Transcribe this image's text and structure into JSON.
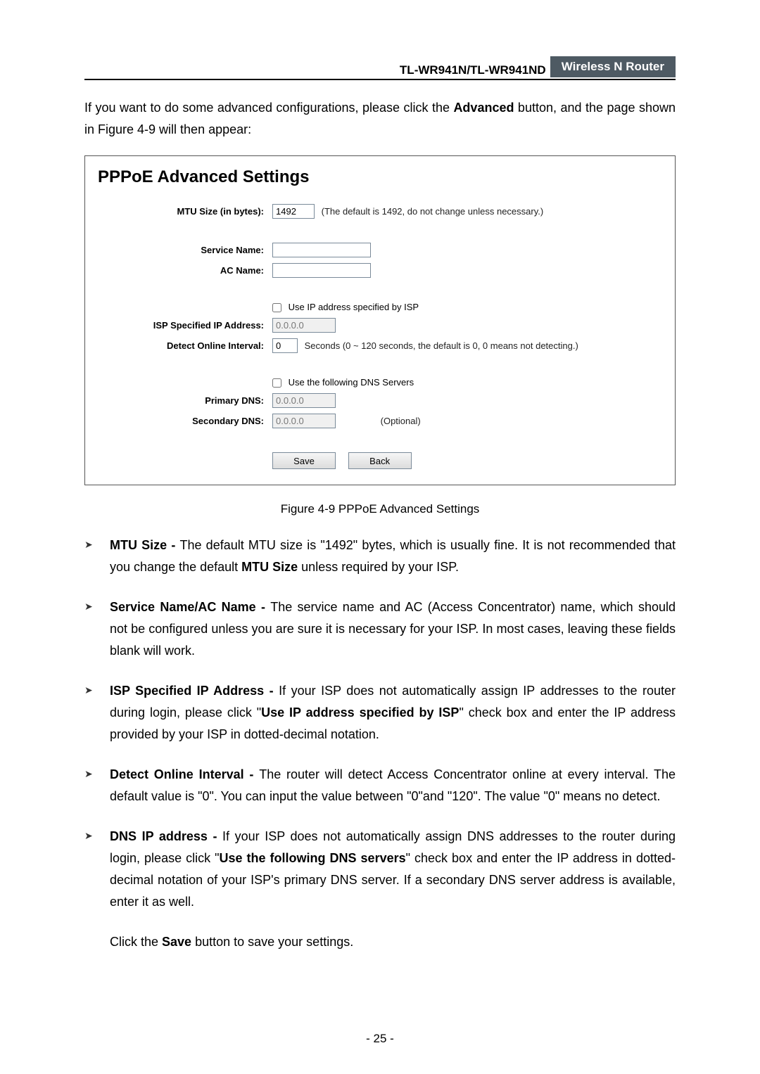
{
  "header": {
    "model": "TL-WR941N/TL-WR941ND",
    "product": "Wireless  N  Router"
  },
  "intro": {
    "p1a": "If you want to do some advanced configurations, please click the ",
    "adv": "Advanced",
    "p1b": " button, and the page shown in Figure 4-9 will then appear:"
  },
  "panel": {
    "title": "PPPoE Advanced Settings",
    "mtu_label": "MTU Size (in bytes):",
    "mtu_value": "1492",
    "mtu_hint": "(The default is 1492, do not change unless necessary.)",
    "service_label": "Service Name:",
    "ac_label": "AC Name:",
    "use_isp_ip": "Use IP address specified by ISP",
    "isp_ip_label": "ISP Specified IP Address:",
    "isp_ip_value": "0.0.0.0",
    "detect_label": "Detect Online Interval:",
    "detect_value": "0",
    "detect_hint": "Seconds (0 ~ 120 seconds, the default is 0, 0 means not detecting.)",
    "use_dns": "Use the following DNS Servers",
    "primary_dns_label": "Primary DNS:",
    "primary_dns_value": "0.0.0.0",
    "secondary_dns_label": "Secondary DNS:",
    "secondary_dns_value": "0.0.0.0",
    "optional": "(Optional)",
    "save": "Save",
    "back": "Back"
  },
  "caption": "Figure 4-9 PPPoE Advanced Settings",
  "bullets": [
    {
      "lead": "MTU Size - ",
      "body_a": "The default MTU size is \"1492\" bytes, which is usually fine. It is not recommended that you change the default ",
      "bold_a": "MTU Size",
      "body_b": " unless required by your ISP."
    },
    {
      "lead": "Service Name/AC Name - ",
      "body_a": "The service name and AC (Access Concentrator) name, which should not be configured unless you are sure it is necessary for your ISP. In most cases, leaving these fields blank will work.",
      "bold_a": "",
      "body_b": ""
    },
    {
      "lead": "ISP Specified IP Address - ",
      "body_a": "If your ISP does not automatically assign IP addresses to the router during login, please click \"",
      "bold_a": "Use IP address specified by ISP",
      "body_b": "\" check box and enter the IP address provided by your ISP in dotted-decimal notation."
    },
    {
      "lead": "Detect Online Interval - ",
      "body_a": "The router will detect Access Concentrator online at every interval. The default value is \"0\". You can input the value between \"0\"and \"120\". The value \"0\" means no detect.",
      "bold_a": "",
      "body_b": ""
    },
    {
      "lead": "DNS IP address - ",
      "body_a": "If your ISP does not automatically assign DNS addresses to the router during login, please click \"",
      "bold_a": "Use the following DNS servers",
      "body_b": "\" check box and enter the IP address in dotted-decimal notation of your ISP's primary DNS server. If a secondary DNS server address is available, enter it as well."
    }
  ],
  "after_a": "Click the ",
  "after_bold": "Save",
  "after_b": " button to save your settings.",
  "pagenum": "- 25 -"
}
